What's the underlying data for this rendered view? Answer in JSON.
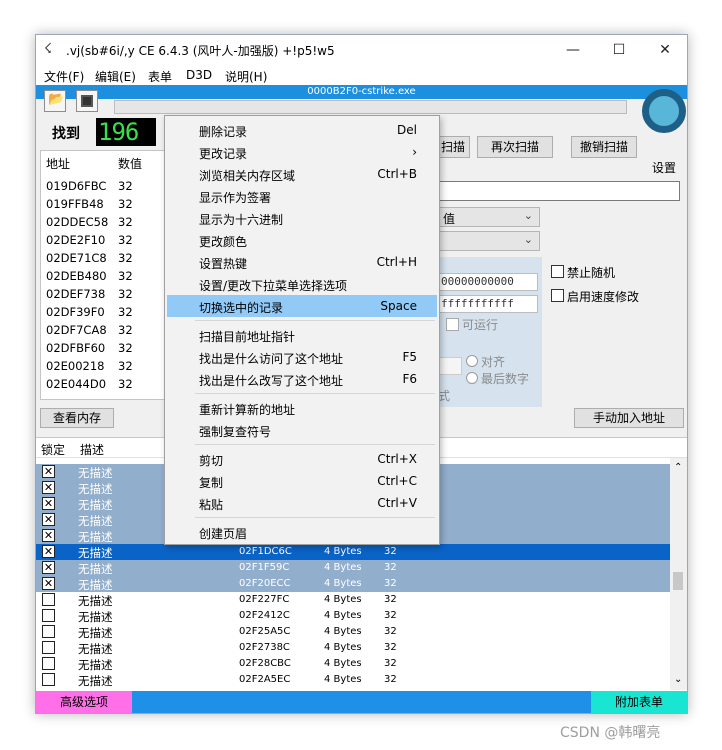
{
  "window": {
    "title": ".vj(sb#6i/,y  CE 6.4.3 (风叶人-加强版)  +!p5!w5",
    "minimize": "—",
    "maximize": "☐",
    "close": "✕"
  },
  "menubar": [
    "文件(F)",
    "编辑(E)",
    "表单",
    "D3D",
    "说明(H)"
  ],
  "process": {
    "name": "0000B2F0-cstrike.exe"
  },
  "scan": {
    "found_label": "找到",
    "found_count": "196",
    "first_scan": "扫描",
    "next_scan": "再次扫描",
    "undo_scan": "撤销扫描",
    "settings": "设置",
    "value_type": "值",
    "hex_start": "00000000000",
    "hex_stop": "fffffffffff",
    "executable": "可运行",
    "align": "对齐",
    "last_digits": "最后数字",
    "fragment": "式",
    "disable_random": "禁止随机",
    "speedhack": "启用速度修改"
  },
  "address_list": {
    "col_address": "地址",
    "col_value": "数值",
    "rows": [
      {
        "address": "019D6FBC",
        "value": "32"
      },
      {
        "address": "019FFB48",
        "value": "32"
      },
      {
        "address": "02DDEC58",
        "value": "32"
      },
      {
        "address": "02DE2F10",
        "value": "32"
      },
      {
        "address": "02DE71C8",
        "value": "32"
      },
      {
        "address": "02DEB480",
        "value": "32"
      },
      {
        "address": "02DEF738",
        "value": "32"
      },
      {
        "address": "02DF39F0",
        "value": "32"
      },
      {
        "address": "02DF7CA8",
        "value": "32"
      },
      {
        "address": "02DFBF60",
        "value": "32"
      },
      {
        "address": "02E00218",
        "value": "32"
      },
      {
        "address": "02E044D0",
        "value": "32"
      }
    ]
  },
  "buttons": {
    "view_memory": "查看内存",
    "add_address_manually": "手动加入地址"
  },
  "context_menu": {
    "items": [
      {
        "label": "删除记录",
        "shortcut": "Del"
      },
      {
        "label": "更改记录",
        "shortcut": "›"
      },
      {
        "label": "浏览相关内存区域",
        "shortcut": "Ctrl+B"
      },
      {
        "label": "显示作为签署",
        "shortcut": ""
      },
      {
        "label": "显示为十六进制",
        "shortcut": ""
      },
      {
        "label": "更改颜色",
        "shortcut": ""
      },
      {
        "label": "设置热键",
        "shortcut": "Ctrl+H"
      },
      {
        "label": "设置/更改下拉菜单选择选项",
        "shortcut": ""
      },
      {
        "label": "切换选中的记录",
        "shortcut": "Space"
      },
      {
        "label": "扫描目前地址指针",
        "shortcut": ""
      },
      {
        "label": "找出是什么访问了这个地址",
        "shortcut": "F5"
      },
      {
        "label": "找出是什么改写了这个地址",
        "shortcut": "F6"
      },
      {
        "label": "重新计算新的地址",
        "shortcut": ""
      },
      {
        "label": "强制复查符号",
        "shortcut": ""
      },
      {
        "label": "剪切",
        "shortcut": "Ctrl+X"
      },
      {
        "label": "复制",
        "shortcut": "Ctrl+C"
      },
      {
        "label": "粘贴",
        "shortcut": "Ctrl+V"
      },
      {
        "label": "创建页眉",
        "shortcut": ""
      }
    ]
  },
  "cheat_table": {
    "col_lock": "锁定",
    "col_desc": "描述",
    "rows": [
      {
        "checked": true,
        "desc": "无描述",
        "address": "",
        "type": "",
        "value": "",
        "state": "sel1"
      },
      {
        "checked": true,
        "desc": "无描述",
        "address": "",
        "type": "",
        "value": "",
        "state": "sel1"
      },
      {
        "checked": true,
        "desc": "无描述",
        "address": "",
        "type": "",
        "value": "",
        "state": "sel1"
      },
      {
        "checked": true,
        "desc": "无描述",
        "address": "",
        "type": "",
        "value": "",
        "state": "sel1"
      },
      {
        "checked": true,
        "desc": "无描述",
        "address": "",
        "type": "",
        "value": "",
        "state": "sel1"
      },
      {
        "checked": true,
        "desc": "无描述",
        "address": "02F1DC6C",
        "type": "4 Bytes",
        "value": "32",
        "state": "sel2"
      },
      {
        "checked": true,
        "desc": "无描述",
        "address": "02F1F59C",
        "type": "4 Bytes",
        "value": "32",
        "state": "sel1"
      },
      {
        "checked": true,
        "desc": "无描述",
        "address": "02F20ECC",
        "type": "4 Bytes",
        "value": "32",
        "state": "sel1"
      },
      {
        "checked": false,
        "desc": "无描述",
        "address": "02F227FC",
        "type": "4 Bytes",
        "value": "32",
        "state": ""
      },
      {
        "checked": false,
        "desc": "无描述",
        "address": "02F2412C",
        "type": "4 Bytes",
        "value": "32",
        "state": ""
      },
      {
        "checked": false,
        "desc": "无描述",
        "address": "02F25A5C",
        "type": "4 Bytes",
        "value": "32",
        "state": ""
      },
      {
        "checked": false,
        "desc": "无描述",
        "address": "02F2738C",
        "type": "4 Bytes",
        "value": "32",
        "state": ""
      },
      {
        "checked": false,
        "desc": "无描述",
        "address": "02F28CBC",
        "type": "4 Bytes",
        "value": "32",
        "state": ""
      },
      {
        "checked": false,
        "desc": "无描述",
        "address": "02F2A5EC",
        "type": "4 Bytes",
        "value": "32",
        "state": ""
      }
    ]
  },
  "statusbar": {
    "advanced": "高级选项",
    "add_table": "附加表单"
  },
  "watermark": "CSDN @韩曙亮"
}
